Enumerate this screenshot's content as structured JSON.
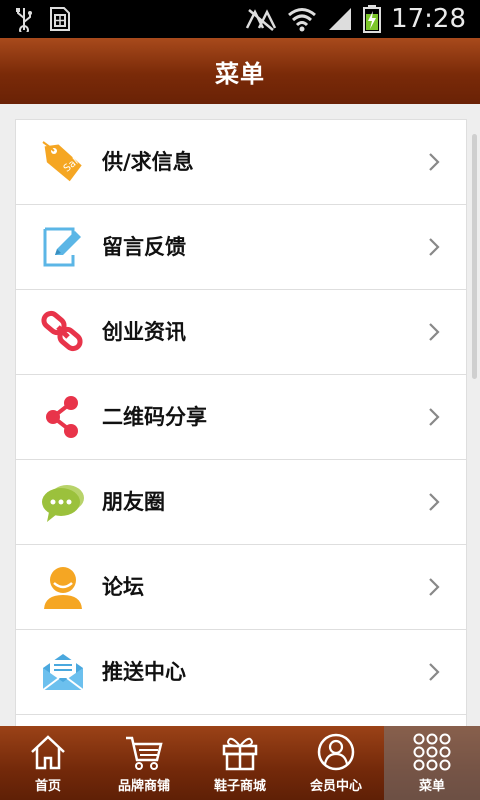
{
  "status_bar": {
    "time": "17:28"
  },
  "header": {
    "title": "菜单"
  },
  "menu": {
    "items": [
      {
        "label": "供/求信息",
        "icon": "sale-tag-icon"
      },
      {
        "label": "留言反馈",
        "icon": "edit-note-icon"
      },
      {
        "label": "创业资讯",
        "icon": "chain-link-icon"
      },
      {
        "label": "二维码分享",
        "icon": "share-icon"
      },
      {
        "label": "朋友圈",
        "icon": "chat-bubbles-icon"
      },
      {
        "label": "论坛",
        "icon": "user-avatar-icon"
      },
      {
        "label": "推送中心",
        "icon": "envelope-icon"
      }
    ]
  },
  "bottom_nav": {
    "items": [
      {
        "label": "首页",
        "icon": "home-icon"
      },
      {
        "label": "品牌商铺",
        "icon": "cart-icon"
      },
      {
        "label": "鞋子商城",
        "icon": "gift-icon"
      },
      {
        "label": "会员中心",
        "icon": "member-icon"
      },
      {
        "label": "菜单",
        "icon": "grid-menu-icon",
        "active": true
      }
    ]
  },
  "colors": {
    "header_brown": "#7a2a08",
    "sale_tag": "#f5a623",
    "edit_blue": "#5bb6e6",
    "link_red": "#e8344a",
    "share_red": "#e8344a",
    "chat_green": "#9bc13c",
    "avatar_orange": "#f5a623",
    "envelope_blue": "#4aa8de"
  }
}
